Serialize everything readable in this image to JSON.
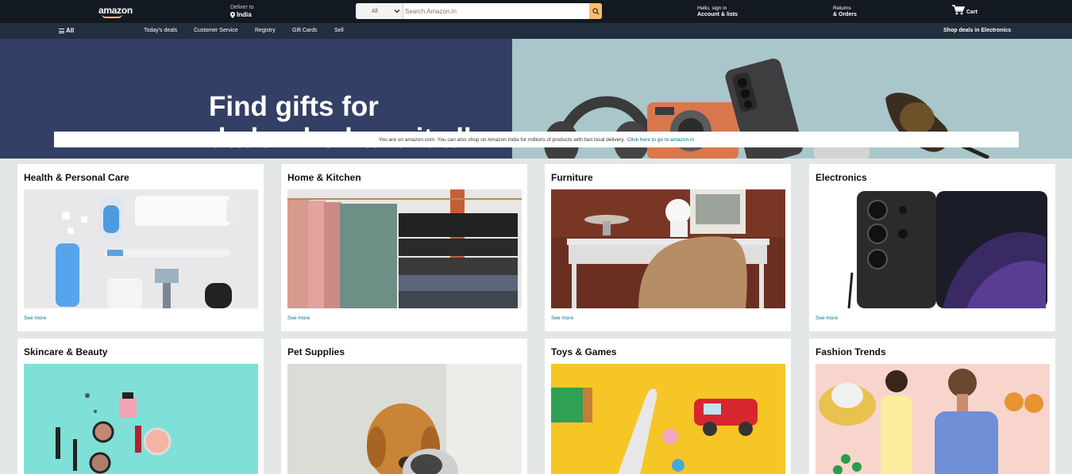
{
  "header": {
    "logo_text": "amazon",
    "deliver_label": "Deliver to",
    "deliver_location": "India",
    "search": {
      "category": "All",
      "placeholder": "Search Amazon.in"
    },
    "account_greeting": "Hello, sign in",
    "account_label": "Account & lists",
    "returns_label": "Returns",
    "orders_label": "& Orders",
    "cart_label": "Cart"
  },
  "subnav": {
    "all_label": "All",
    "links": [
      "Today's deals",
      "Customer Service",
      "Registry",
      "Gift Cards",
      "Sell"
    ],
    "promo": "Shop deals in Electronics"
  },
  "hero": {
    "title_line1": "Find gifts for",
    "title_line2": "dads who have it all"
  },
  "notice": {
    "text": "You are on amazon.com. You can also shop on Amazon India for millions of products with fast local delivery.",
    "link": "Click here to go to amazon.in"
  },
  "cards": [
    {
      "title": "Health & Personal Care",
      "more": "See more"
    },
    {
      "title": "Home & Kitchen",
      "more": "See more"
    },
    {
      "title": "Furniture",
      "more": "See more"
    },
    {
      "title": "Electronics",
      "more": "See more"
    },
    {
      "title": "Skincare & Beauty",
      "more": ""
    },
    {
      "title": "Pet Supplies",
      "more": ""
    },
    {
      "title": "Toys & Games",
      "more": ""
    },
    {
      "title": "Fashion Trends",
      "more": ""
    }
  ],
  "colors": {
    "nav_top": "#131921",
    "nav_sub": "#232f3e",
    "search_button": "#febd69",
    "link": "#007185",
    "hero_left": "#343f65",
    "hero_right": "#a9c7ca",
    "page_bg": "#e3e6e6"
  }
}
